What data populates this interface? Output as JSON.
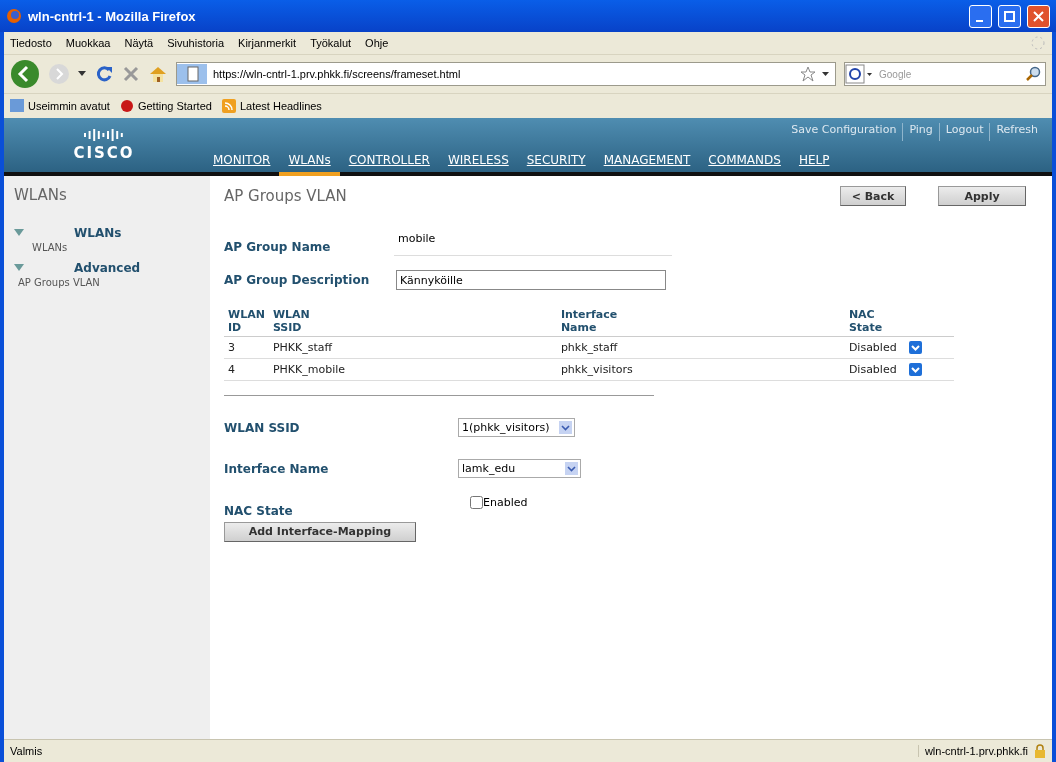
{
  "window": {
    "title": "wln-cntrl-1 - Mozilla Firefox"
  },
  "menu": [
    "Tiedosto",
    "Muokkaa",
    "Näytä",
    "Sivuhistoria",
    "Kirjanmerkit",
    "Työkalut",
    "Ohje"
  ],
  "address": {
    "value": "https://wln-cntrl-1.prv.phkk.fi/screens/frameset.html"
  },
  "search": {
    "placeholder": "Google"
  },
  "bookmarks": [
    "Useimmin avatut",
    "Getting Started",
    "Latest Headlines"
  ],
  "header": {
    "logo": "CISCO",
    "links": [
      "Save Configuration",
      "Ping",
      "Logout",
      "Refresh"
    ],
    "tabs": [
      {
        "label": "MONITOR",
        "selected": false
      },
      {
        "label": "WLANs",
        "selected": true
      },
      {
        "label": "CONTROLLER",
        "selected": false
      },
      {
        "label": "WIRELESS",
        "selected": false
      },
      {
        "label": "SECURITY",
        "selected": false
      },
      {
        "label": "MANAGEMENT",
        "selected": false
      },
      {
        "label": "COMMANDS",
        "selected": false
      },
      {
        "label": "HELP",
        "selected": false
      }
    ]
  },
  "sidebar": {
    "title": "WLANs",
    "groups": [
      {
        "label": "WLANs",
        "expanded": true,
        "children": [
          {
            "label": "WLANs"
          }
        ]
      },
      {
        "label": "Advanced",
        "expanded": true,
        "children": [
          {
            "label": "AP Groups VLAN"
          }
        ]
      }
    ]
  },
  "page": {
    "title": "AP Groups VLAN",
    "buttons": [
      "< Back",
      "Apply"
    ],
    "group_name": {
      "label": "AP Group Name",
      "value": "mobile"
    },
    "group_description": {
      "label": "AP Group Description",
      "value": "Kännyköille"
    },
    "table": {
      "columns": [
        "WLAN ID",
        "WLAN SSID",
        "Interface Name",
        "NAC State"
      ],
      "rows": [
        [
          "3",
          "PHKK_staff",
          "phkk_staff",
          "Disabled"
        ],
        [
          "4",
          "PHKK_mobile",
          "phkk_visitors",
          "Disabled"
        ]
      ]
    },
    "ssid": {
      "label": "WLAN SSID",
      "value": "1(phkk_visitors)"
    },
    "interface": {
      "label": "Interface Name",
      "value": "lamk_edu"
    },
    "nac": {
      "label": "NAC State",
      "option": "Enabled",
      "checked": false
    },
    "add_button": "Add Interface-Mapping"
  },
  "status_bar": {
    "text": "Valmis",
    "host": "wln-cntrl-1.prv.phkk.fi"
  }
}
